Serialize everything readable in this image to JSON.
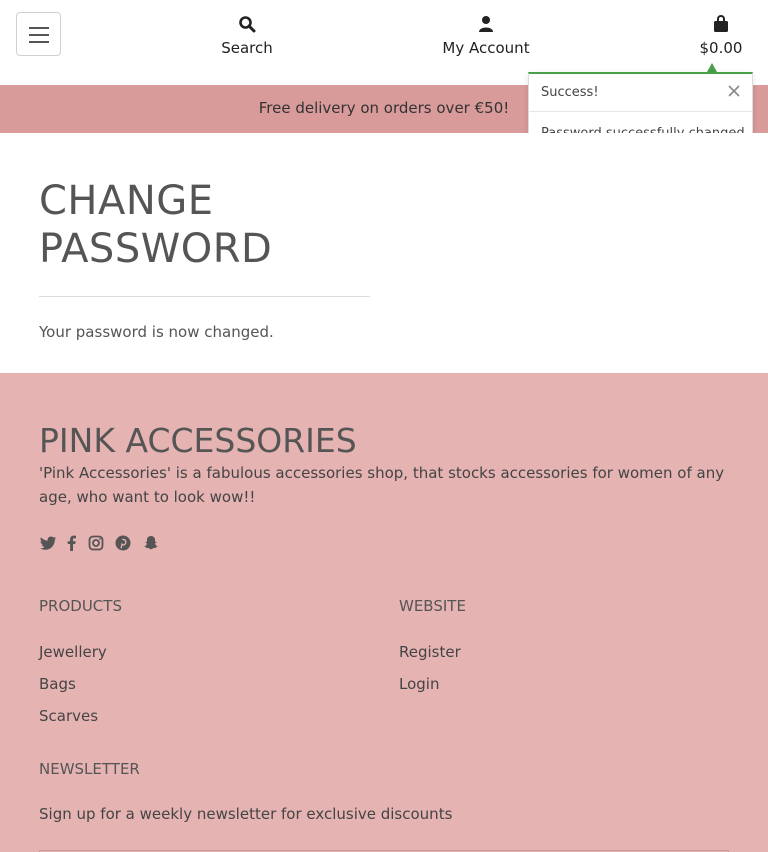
{
  "header": {
    "menu_icon": "hamburger-icon",
    "search": {
      "label": "Search",
      "icon": "search-icon"
    },
    "account": {
      "label": "My Account",
      "icon": "user-icon"
    },
    "cart": {
      "total": "$0.00",
      "icon": "shopping-bag-icon"
    }
  },
  "banner": {
    "text": "Free delivery on orders over €50!"
  },
  "toast": {
    "title": "Success!",
    "message": "Password successfully changed.",
    "accent": "#48a04a"
  },
  "main": {
    "title_line1": "CHANGE",
    "title_line2": "PASSWORD",
    "text": "Your password is now changed."
  },
  "footer": {
    "brand": "PINK ACCESSORIES",
    "about": "'Pink Accessories' is a fabulous accessories shop, that stocks accessories for women of any age, who want to look wow!!",
    "social_icons": [
      "twitter-icon",
      "facebook-icon",
      "instagram-icon",
      "pinterest-icon",
      "snapchat-icon"
    ],
    "products": {
      "heading": "PRODUCTS",
      "links": [
        "Jewellery",
        "Bags",
        "Scarves"
      ]
    },
    "website": {
      "heading": "WEBSITE",
      "links": [
        "Register",
        "Login"
      ]
    },
    "newsletter": {
      "heading": "NEWSLETTER",
      "text": "Sign up for a weekly newsletter for exclusive discounts"
    },
    "background": "#e6b3b3"
  },
  "colors": {
    "banner": "#d99a9a",
    "footer": "#e6b3b3",
    "text": "#555555"
  }
}
